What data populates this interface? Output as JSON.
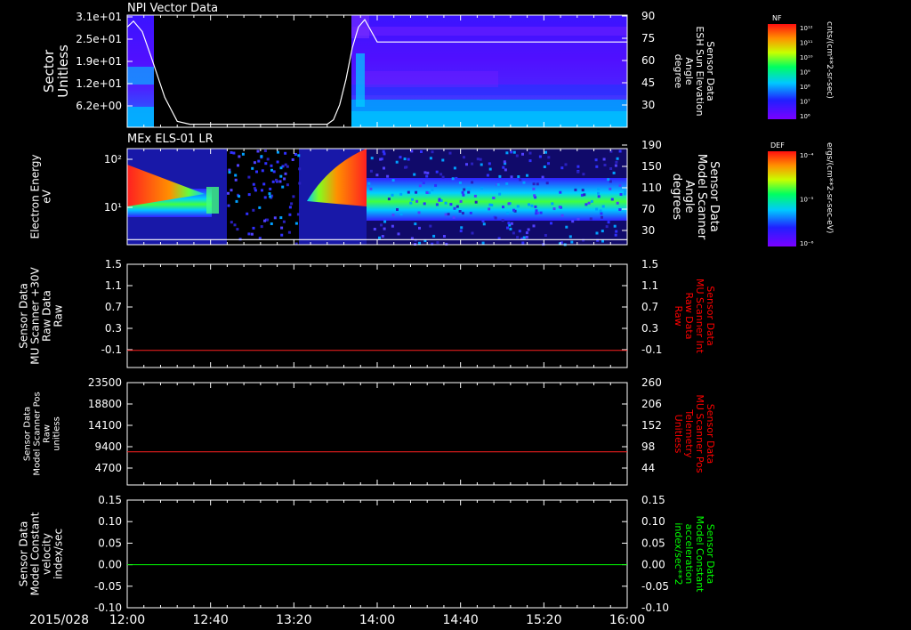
{
  "date_label": "2015/028",
  "time_ticks": [
    "12:00",
    "12:40",
    "13:20",
    "14:00",
    "14:40",
    "15:20",
    "16:00"
  ],
  "time_range_hours": [
    12,
    16
  ],
  "colorbars": [
    {
      "label": "NF",
      "unit": "cnts/(cm**2-sr-sec)",
      "ticks": [
        "10¹²",
        "10¹¹",
        "10¹⁰",
        "10⁹",
        "10⁸",
        "10⁷",
        "10⁶"
      ]
    },
    {
      "label": "DEF",
      "unit": "ergs/(cm**2-sr-sec-eV)",
      "ticks": [
        "10⁻⁴",
        "10⁻⁵",
        "10⁻⁶"
      ]
    }
  ],
  "chart_data": [
    {
      "type": "heatmap",
      "title": "NPI Vector Data",
      "ylabel": [
        "Sector",
        "Unitless"
      ],
      "y_ticks": [
        "3.1e+01",
        "2.5e+01",
        "1.9e+01",
        "1.2e+01",
        "6.2e+00"
      ],
      "y2label": [
        "Sensor Data",
        "ESH Sun Elevation",
        "Angle",
        "degree"
      ],
      "y2_ticks": [
        "90",
        "75",
        "60",
        "45",
        "30"
      ],
      "y2_range": [
        15,
        90
      ],
      "overlay_line": {
        "color": "#ffffff",
        "x": [
          12.0,
          12.05,
          12.12,
          12.2,
          12.3,
          12.4,
          12.5,
          13.0,
          13.2,
          13.5,
          13.6,
          13.65,
          13.7,
          13.75,
          13.8,
          13.85,
          13.9,
          14.0,
          14.2,
          16.0
        ],
        "y": [
          82,
          86,
          79,
          60,
          35,
          19,
          17,
          17,
          17,
          17,
          17,
          20,
          30,
          47,
          68,
          82,
          87,
          72,
          72,
          72
        ]
      },
      "data_gaps": [
        [
          12.33,
          13.58
        ]
      ],
      "line_color": "#ffffff"
    },
    {
      "type": "heatmap",
      "title": "MEx ELS-01 LR",
      "ylabel": [
        "Electron Energy",
        "eV"
      ],
      "y_ticks": [
        "10²",
        "10¹"
      ],
      "y2label": [
        "Sensor Data",
        "Model Scanner",
        "Angle",
        "degrees"
      ],
      "y2_ticks": [
        "190",
        "150",
        "110",
        "70",
        "30"
      ],
      "y2_range": [
        0,
        190
      ],
      "overlay_line": {
        "color": "#ffffff",
        "x": [
          12.0,
          16.0
        ],
        "y": [
          10,
          10
        ]
      }
    },
    {
      "type": "line",
      "ylabel": [
        "Sensor Data",
        "MU Scanner +30V",
        "Raw Data",
        "Raw"
      ],
      "y_ticks": [
        "1.5",
        "1.1",
        "0.7",
        "0.3",
        "-0.1"
      ],
      "ylim": [
        -0.3,
        1.5
      ],
      "y2label": [
        "Sensor Data",
        "MU Scanner Int",
        "Raw Data",
        "Raw"
      ],
      "y2_ticks": [
        "1.5",
        "1.1",
        "0.7",
        "0.3",
        "-0.1"
      ],
      "y2_color": "#ff0000",
      "series": [
        {
          "color": "#ff2020",
          "x": [
            12.0,
            16.0
          ],
          "y": [
            0.0,
            0.0
          ]
        }
      ]
    },
    {
      "type": "line",
      "ylabel": [
        "Sensor Data",
        "Model Scanner Pos",
        "Raw",
        "unitless"
      ],
      "y_ticks": [
        "23500",
        "18800",
        "14100",
        "9400",
        "4700"
      ],
      "ylim": [
        0,
        23500
      ],
      "y2label": [
        "Sensor Data",
        "MU Scanner Pos",
        "Telemetry",
        "Unitless"
      ],
      "y2_ticks": [
        "260",
        "206",
        "152",
        "98",
        "44"
      ],
      "y2_color": "#ff0000",
      "series": [
        {
          "color": "#ff2020",
          "x": [
            12.0,
            16.0
          ],
          "y": [
            7600,
            7600
          ]
        }
      ]
    },
    {
      "type": "line",
      "ylabel": [
        "Sensor Data",
        "Model Constant",
        "velocity",
        "index/sec"
      ],
      "y_ticks": [
        "0.15",
        "0.10",
        "0.05",
        "0.00",
        "-0.05",
        "-0.10"
      ],
      "ylim": [
        -0.1,
        0.15
      ],
      "y2label": [
        "Sensor Data",
        "Model Constant",
        "acceleration",
        "index/sec**2"
      ],
      "y2_ticks": [
        "0.15",
        "0.10",
        "0.05",
        "0.00",
        "-0.05",
        "-0.10"
      ],
      "y2_color": "#00ff00",
      "series": [
        {
          "color": "#00ff00",
          "x": [
            12.0,
            16.0
          ],
          "y": [
            0.0,
            0.0
          ]
        }
      ]
    }
  ]
}
